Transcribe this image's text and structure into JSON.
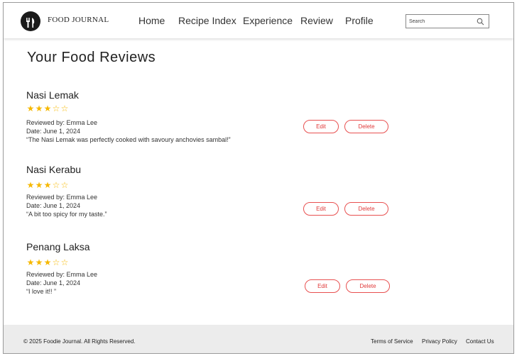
{
  "header": {
    "brand": "FOOD JOURNAL",
    "nav": [
      "Home",
      "Recipe Index",
      "Experience",
      "Review",
      "Profile"
    ],
    "search_placeholder": "Search"
  },
  "main": {
    "title": "Your Food Reviews",
    "reviews": [
      {
        "name": "Nasi Lemak",
        "rating": 3,
        "max_rating": 5,
        "reviewed_by": "Reviewed by: Emma Lee",
        "date": "Date: June 1, 2024",
        "comment": "“The Nasi Lemak was perfectly cooked with savoury anchovies sambal!”",
        "edit_label": "Edit",
        "delete_label": "Delete"
      },
      {
        "name": "Nasi Kerabu",
        "rating": 3,
        "max_rating": 5,
        "reviewed_by": "Reviewed by: Emma Lee",
        "date": "Date: June 1, 2024",
        "comment": "“A bit too spicy for my taste.”",
        "edit_label": "Edit",
        "delete_label": "Delete"
      },
      {
        "name": "Penang Laksa",
        "rating": 3,
        "max_rating": 5,
        "reviewed_by": "Reviewed by: Emma Lee",
        "date": "Date: June 1, 2024",
        "comment": "“I love it!! ”",
        "edit_label": "Edit",
        "delete_label": "Delete"
      }
    ]
  },
  "footer": {
    "copyright": "© 2025 Foodie Journal. All Rights Reserved.",
    "links": [
      "Terms of Service",
      "Privacy Policy",
      "Contact Us"
    ]
  },
  "colors": {
    "star": "#f6b800",
    "button_accent": "#e85050",
    "footer_bg": "#ececec"
  }
}
